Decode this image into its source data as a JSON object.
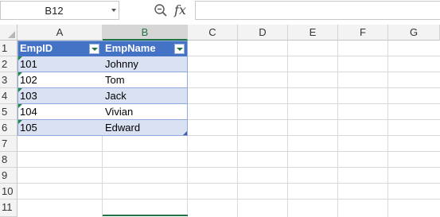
{
  "formula_bar": {
    "name_box": "B12",
    "fx_label": "fx",
    "formula": ""
  },
  "columns": [
    "A",
    "B",
    "C",
    "D",
    "E",
    "F",
    "G"
  ],
  "selected_column": "B",
  "rows": [
    "1",
    "2",
    "3",
    "4",
    "5",
    "6",
    "7",
    "8",
    "9",
    "10",
    "11"
  ],
  "table": {
    "headers": [
      "EmpID",
      "EmpName"
    ],
    "rows": [
      [
        "101",
        "Johnny"
      ],
      [
        "102",
        "Tom"
      ],
      [
        "103",
        "Jack"
      ],
      [
        "104",
        "Vivian"
      ],
      [
        "105",
        "Edward"
      ]
    ]
  },
  "colors": {
    "header_fill": "#4472c4",
    "band_fill": "#d9e1f2",
    "accent": "#217346"
  },
  "icons": [
    "dropdown-arrow-icon",
    "zoom-icon",
    "fx-icon",
    "filter-dropdown-icon"
  ]
}
